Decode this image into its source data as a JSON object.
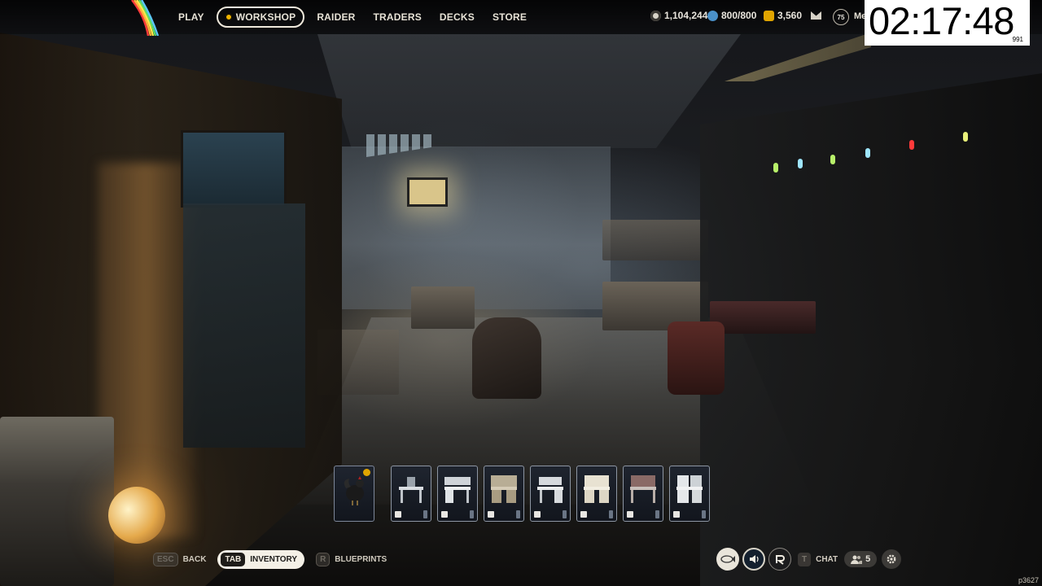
{
  "nav": {
    "items": [
      {
        "label": "PLAY",
        "active": false
      },
      {
        "label": "WORKSHOP",
        "active": true
      },
      {
        "label": "RAIDER",
        "active": false
      },
      {
        "label": "TRADERS",
        "active": false
      },
      {
        "label": "DECKS",
        "active": false
      },
      {
        "label": "STORE",
        "active": false
      }
    ]
  },
  "currencies": {
    "coins": {
      "value": "1,104,244",
      "icon": "coin-icon",
      "color": "#d8d4c8"
    },
    "raider_tokens": {
      "value": "800/800",
      "icon": "token-icon",
      "color": "#4a90c8"
    },
    "credits": {
      "value": "3,560",
      "icon": "credits-icon",
      "color": "#e0a400"
    }
  },
  "player": {
    "level": "75",
    "name": "Meg"
  },
  "timer": {
    "clock": "02:17:48",
    "sub": "991"
  },
  "hotbar": {
    "slots": [
      {
        "name": "rooster",
        "icon": "rooster-icon",
        "has_coin": true
      },
      {
        "name": "workbench-1",
        "icon": "bench-icon"
      },
      {
        "name": "workbench-2",
        "icon": "shield-icon"
      },
      {
        "name": "workbench-3",
        "icon": "flame-icon"
      },
      {
        "name": "workbench-4",
        "icon": "cross-icon"
      },
      {
        "name": "workbench-5",
        "icon": "medkit-icon"
      },
      {
        "name": "workbench-6",
        "icon": "grenade-icon"
      },
      {
        "name": "workbench-7",
        "icon": "grid-icon"
      }
    ]
  },
  "bottom": {
    "back_key": "ESC",
    "back_label": "BACK",
    "inventory_key": "TAB",
    "inventory_label": "INVENTORY",
    "blueprints_key": "R",
    "blueprints_label": "BLUEPRINTS",
    "chat_key": "T",
    "chat_label": "CHAT",
    "friends_count": "5"
  },
  "build_id": "p3627"
}
